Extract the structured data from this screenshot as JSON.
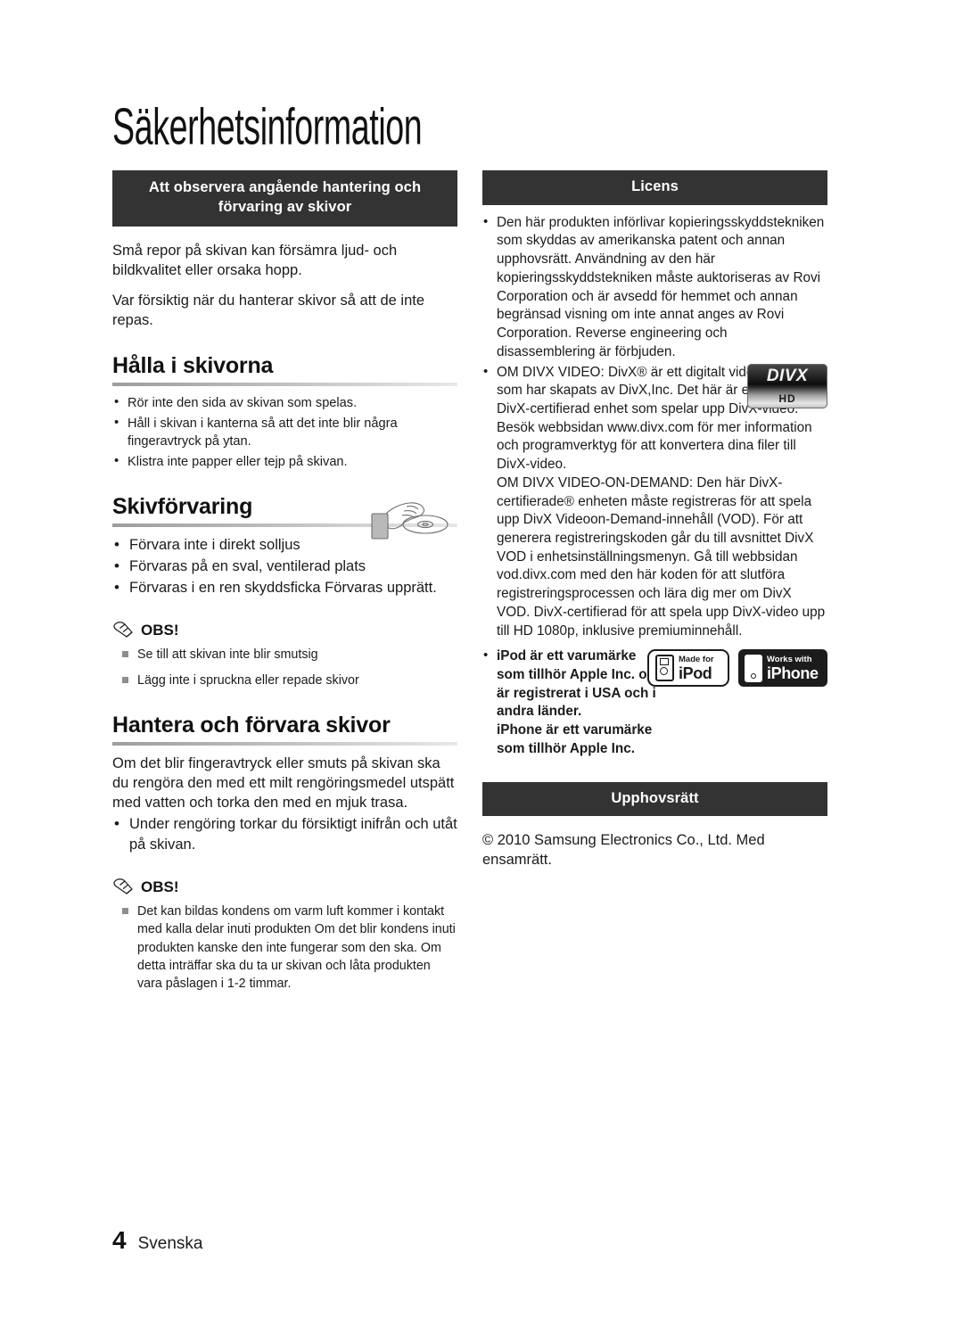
{
  "page": {
    "title": "Säkerhetsinformation",
    "footer": {
      "page_number": "4",
      "language": "Svenska"
    },
    "colors": {
      "banner_background": "#333333",
      "banner_text": "#ffffff",
      "body_text": "#1b1b1b",
      "rule_start": "#9d9d9d",
      "rule_end": "#e8e8e8"
    }
  },
  "left_column": {
    "banner": "Att observera angående hantering och förvaring av skivor",
    "intro_paragraphs": [
      "Små repor på skivan kan försämra ljud- och bildkvalitet eller orsaka hopp.",
      "Var försiktig när du hanterar skivor så att de inte repas."
    ],
    "section_hold": {
      "heading": "Hålla i skivorna",
      "bullets": [
        "Rör inte den sida av skivan som spelas.",
        "Håll i skivan i kanterna så att det inte blir några fingeravtryck på ytan.",
        "Klistra inte papper eller tejp på skivan."
      ]
    },
    "section_storage": {
      "heading": "Skivförvaring",
      "bullets": [
        "Förvara inte i direkt solljus",
        "Förvaras på en sval, ventilerad plats",
        "Förvaras i en ren skyddsficka Förvaras upprätt."
      ],
      "note": {
        "label": "OBS!",
        "items": [
          "Se till att skivan inte blir smutsig",
          "Lägg inte i spruckna eller repade skivor"
        ]
      },
      "illustration_name": "hand-holding-disc-illustration"
    },
    "section_handle": {
      "heading": "Hantera och förvara skivor",
      "paragraph": "Om det blir fingeravtryck eller smuts på skivan ska du rengöra den med ett milt rengöringsmedel utspätt med vatten och torka den med en mjuk trasa.",
      "bullets": [
        "Under rengöring torkar du försiktigt inifrån och utåt på skivan."
      ],
      "note": {
        "label": "OBS!",
        "items": [
          "Det kan bildas kondens om varm luft kommer i kontakt med kalla delar inuti produkten Om det blir kondens inuti produkten kanske den inte fungerar som den ska. Om detta inträffar ska du ta ur skivan och låta produkten vara påslagen i 1-2 timmar."
        ]
      }
    }
  },
  "right_column": {
    "license": {
      "banner": "Licens",
      "bullets": [
        "Den här produkten införlivar kopieringsskyddstekniken som skyddas av amerikanska patent och annan upphovsrätt. Användning av den här kopieringsskyddstekniken måste auktoriseras av Rovi Corporation och är avsedd för hemmet och annan begränsad visning om inte annat anges av Rovi Corporation. Reverse engineering och disassemblering är förbjuden.",
        "OM DIVX VIDEO: DivX® är ett digitalt videoformat som har skapats av DivX,Inc. Det här är en officiell DivX-certifierad enhet som spelar upp DivX-video. Besök webbsidan www.divx.com för mer information och programverktyg för att konvertera dina filer till DivX-video.\nOM DIVX VIDEO-ON-DEMAND: Den här DivX-certifierade® enheten måste registreras för att spela upp DivX Videoon-Demand-innehåll (VOD). För att generera registreringskoden går du till avsnittet DivX VOD i enhetsinställningsmenyn. Gå till webbsidan vod.divx.com med den här koden för att slutföra registreringsprocessen och lära dig mer om DivX VOD. DivX-certifierad för att spela upp DivX-video upp till HD 1080p, inklusive premiuminnehåll.",
        "iPod är ett varumärke som tillhör Apple Inc. och är registrerat i USA och i andra länder.\niPhone är ett varumärke som tillhör Apple Inc."
      ],
      "divx_logo": {
        "word": "DIVX",
        "sub": "HD"
      },
      "apple_badges": {
        "ipod": {
          "small": "Made for",
          "big": "iPod"
        },
        "iphone": {
          "small": "Works with",
          "big": "iPhone"
        }
      }
    },
    "copyright": {
      "banner": "Upphovsrätt",
      "text": "© 2010 Samsung Electronics Co., Ltd. Med ensamrätt."
    }
  }
}
